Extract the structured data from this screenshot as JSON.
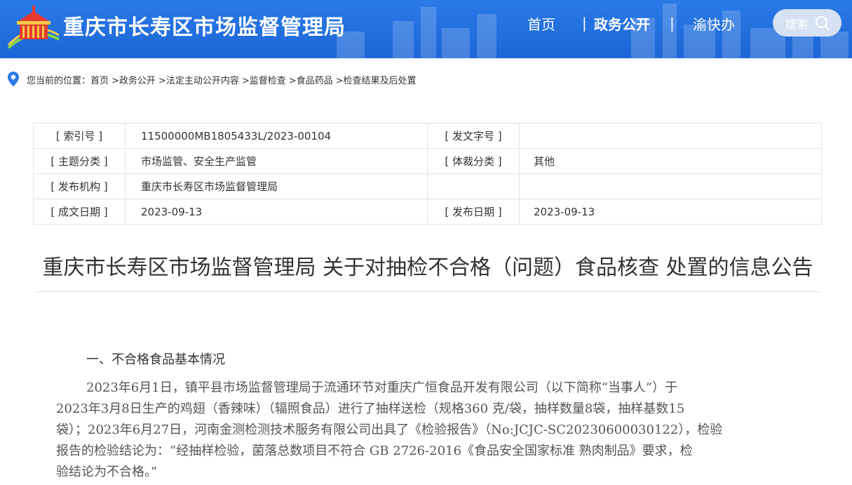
{
  "header": {
    "site_title": "重庆市长寿区市场监督管理局",
    "nav": {
      "home": "首页",
      "sep": "|",
      "gov": "政务公开",
      "fast": "渝快办"
    },
    "search_label": "搜索"
  },
  "breadcrumb": {
    "prefix": "您当前的位置：",
    "items": [
      "首页",
      ">政务公开",
      ">法定主动公开内容",
      ">监督检查",
      ">食品药品",
      ">检查结果及后处置"
    ]
  },
  "meta": {
    "index_key": "[ 索引号 ]",
    "index_val": "11500000MB1805433L/2023-00104",
    "docno_key": "[ 发文字号 ]",
    "docno_val": "",
    "topic_key": "[ 主题分类 ]",
    "topic_val": "市场监管、安全生产监管",
    "genre_key": "[ 体裁分类 ]",
    "genre_val": "其他",
    "org_key": "[ 发布机构 ]",
    "org_val": "重庆市长寿区市场监督管理局",
    "created_key": "[ 成文日期 ]",
    "created_val": "2023-09-13",
    "pub_key": "[ 发布日期 ]",
    "pub_val": "2023-09-13"
  },
  "doc": {
    "title": "重庆市长寿区市场监督管理局 关于对抽检不合格（问题）食品核查 处置的信息公告",
    "section1_heading": "一、不合格食品基本情况",
    "para_lines": [
      "2023年6月1日，镇平县市场监督管理局于流通环节对重庆广恒食品开发有限公司（以下简称“当事人”）于",
      "2023年3月8日生产的鸡翅（香辣味）（辐照食品）进行了抽样送检（规格360 克/袋，抽样数量8袋，抽样基数15",
      "袋）；2023年6月27日，河南金测检测技术服务有限公司出具了《检验报告》（No:JCJC-SC20230600030122），检验",
      "报告的检验结论为：“经抽样检验，菌落总数项目不符合 GB 2726-2016《食品安全国家标准 熟肉制品》要求，检",
      "验结论为不合格。”"
    ]
  },
  "colors": {
    "header_blue": "#1f6ee0",
    "search_bg": "#d6e1f4",
    "pin_blue": "#2a7ae8"
  },
  "icons": {
    "logo": "great-hall-emblem-icon",
    "search": "search-icon",
    "location": "location-pin-icon"
  }
}
